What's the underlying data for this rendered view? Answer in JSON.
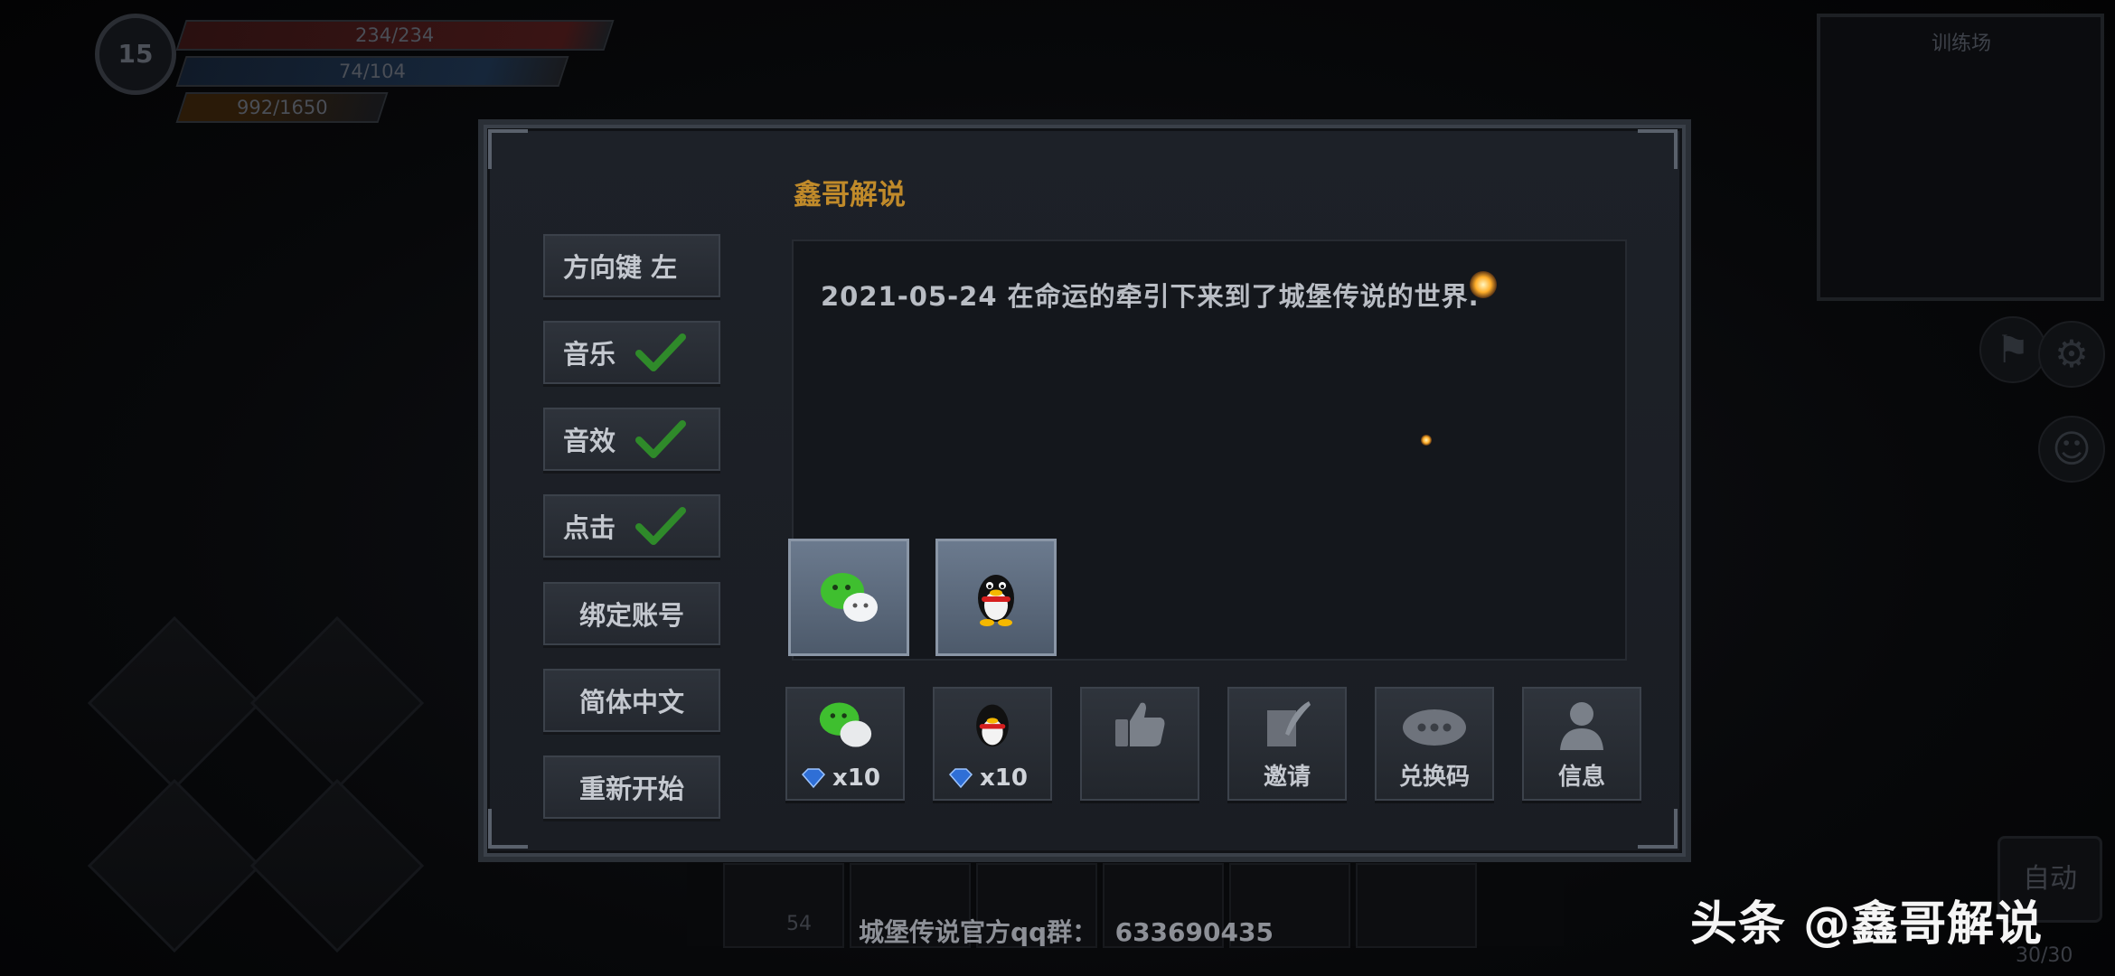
{
  "hud": {
    "level": "15",
    "hp": "234/234",
    "mp": "74/104",
    "xp": "992/1650",
    "minimap_label": "训练场",
    "auto_label": "自动",
    "auto_count": "30/30",
    "hotbar_count": "54"
  },
  "modal": {
    "title": "鑫哥解说",
    "content_text": "2021-05-24 在命运的牵引下来到了城堡传说的世界.",
    "settings": [
      {
        "label": "方向键 左",
        "checked": false
      },
      {
        "label": "音乐",
        "checked": true
      },
      {
        "label": "音效",
        "checked": true
      },
      {
        "label": "点击",
        "checked": true
      },
      {
        "label": "绑定账号",
        "checked": false
      },
      {
        "label": "简体中文",
        "checked": false
      },
      {
        "label": "重新开始",
        "checked": false
      }
    ],
    "share_buttons": [
      {
        "icon": "wechat-icon"
      },
      {
        "icon": "qq-icon"
      }
    ],
    "actions": [
      {
        "icon": "wechat-icon",
        "reward": "x10"
      },
      {
        "icon": "qq-icon",
        "reward": "x10"
      },
      {
        "icon": "thumbs-up-icon",
        "label": ""
      },
      {
        "icon": "invite-quill-icon",
        "label": "邀请"
      },
      {
        "icon": "redeem-code-icon",
        "label": "兑换码"
      },
      {
        "icon": "user-profile-icon",
        "label": "信息"
      }
    ],
    "colors": {
      "title": "#c08a2a",
      "check": "#2f8a2a"
    }
  },
  "footer": {
    "qq_group": "城堡传说官方qq群：  633690435"
  },
  "watermark": "头条 @鑫哥解说"
}
